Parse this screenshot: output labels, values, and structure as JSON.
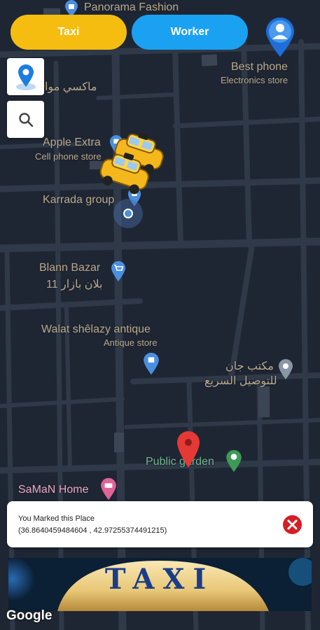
{
  "header": {
    "taxi_label": "Taxi",
    "worker_label": "Worker"
  },
  "map": {
    "labels": {
      "panorama": "Panorama Fashion",
      "best_phone": "Best phone",
      "best_phone_sub": "Electronics store",
      "makasi": "ماكسي موا",
      "apple_extra": "Apple Extra",
      "apple_extra_sub": "Cell phone store",
      "karrada": "Karrada group",
      "blann": "Blann Bazar",
      "blann_ar": "11 بلان بازار",
      "walat": "Walat shêlazy antique",
      "walat_sub": "Antique store",
      "maktab": "مكتب جان",
      "maktab2": "للتوصيل السريع",
      "public_garden": "Public garden",
      "saman": "SaMaN Home"
    },
    "attribution": "Google"
  },
  "marked_place": {
    "title": "You Marked this Place",
    "coords": "(36.8640459484604 , 42.97255374491215)"
  },
  "banner": {
    "text": "TAXI"
  },
  "colors": {
    "taxi": "#f6bd11",
    "worker": "#1ba1f2",
    "map_bg": "#1f2633",
    "road": "#2f3948",
    "close": "#d41f26"
  }
}
